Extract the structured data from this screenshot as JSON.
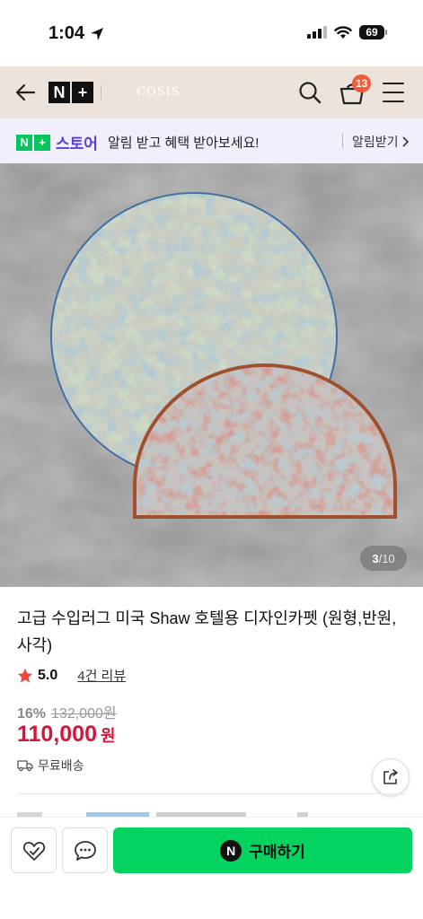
{
  "status_bar": {
    "time": "1:04",
    "battery": "69"
  },
  "header": {
    "logo_n": "N",
    "logo_plus": "+",
    "brand": "COSIS",
    "cart_count": "13"
  },
  "notice": {
    "logo_n": "N",
    "logo_plus": "+",
    "store_label": "스토어",
    "message": "알림 받고 혜택 받아보세요!",
    "action": "알림받기"
  },
  "gallery": {
    "current": "3",
    "separator": " / ",
    "total": "10"
  },
  "product": {
    "title": "고급 수입러그 미국 Shaw 호텔용 디자인카펫 (원형,반원, 사각)",
    "rating": "5.0",
    "review_count_label": "4건 리뷰",
    "discount_rate": "16%",
    "original_price": "132,000원",
    "sale_price": "110,000",
    "price_unit": "원",
    "shipping": "무료배송"
  },
  "bottom_bar": {
    "buy_icon": "N",
    "buy_label": "구매하기"
  },
  "colors": {
    "accent_green": "#05d35f",
    "price_red": "#d4163c",
    "badge_orange": "#f25c3a",
    "store_purple": "#5b3fd6",
    "header_bg": "#ece4dc"
  },
  "icons": {
    "back": "arrow-left-icon",
    "search": "search-icon",
    "cart": "shopping-bag-icon",
    "menu": "hamburger-menu-icon",
    "star": "star-icon",
    "shipping": "truck-icon",
    "share": "share-icon",
    "wish": "heart-icon",
    "talk": "chat-bubble-icon"
  }
}
